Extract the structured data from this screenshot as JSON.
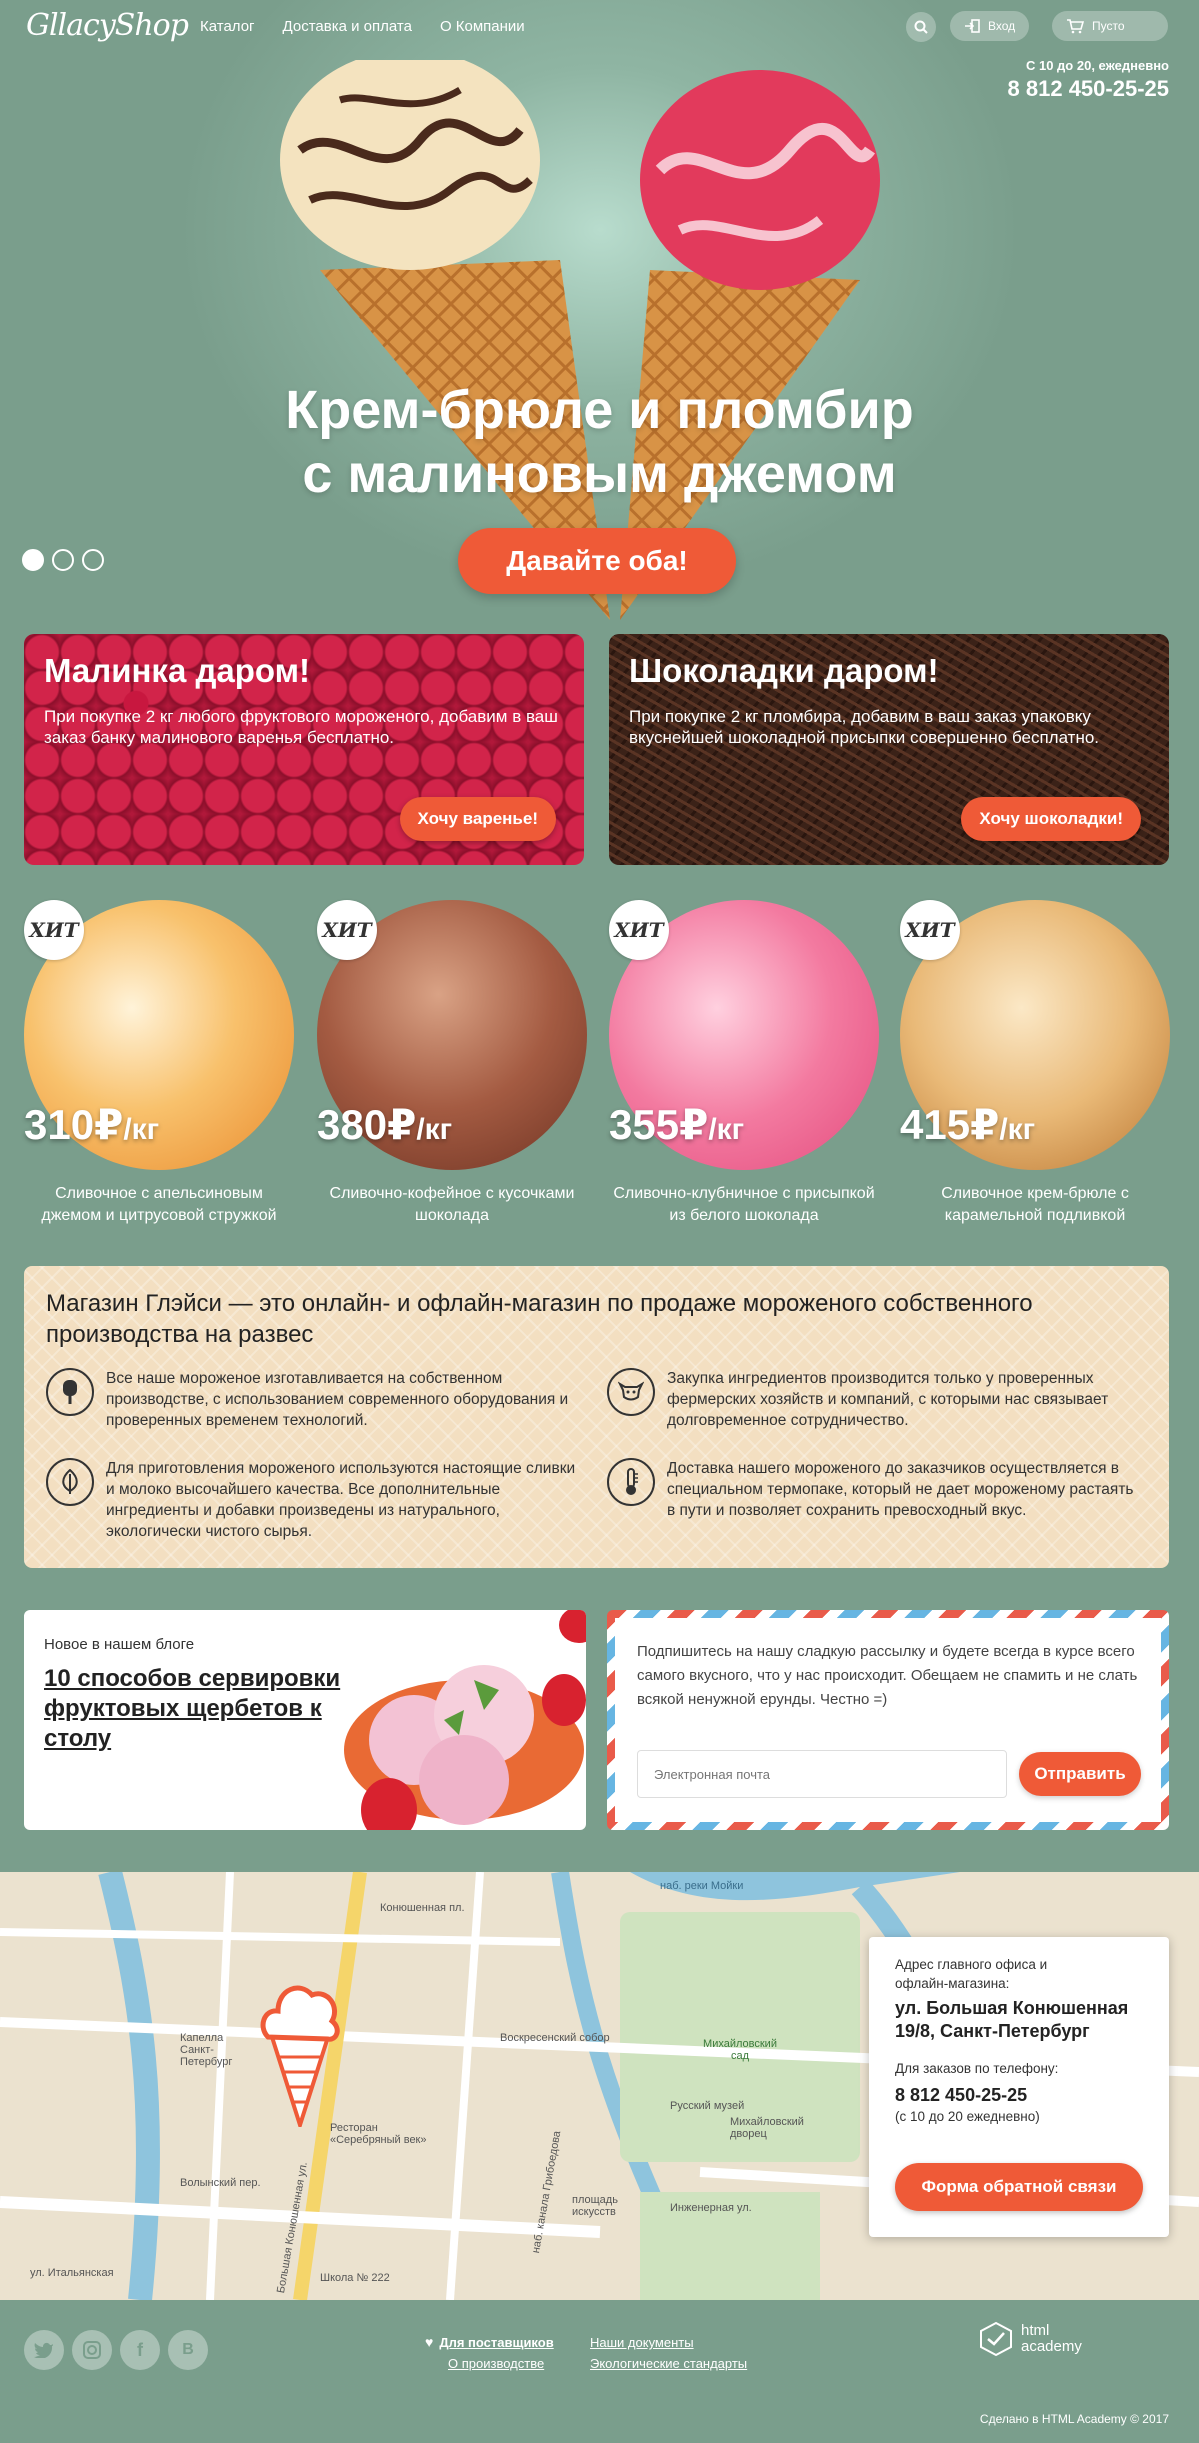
{
  "header": {
    "logo": "GllacyShop",
    "nav": [
      "Каталог",
      "Доставка и оплата",
      "О Компании"
    ],
    "login_label": "Вход",
    "cart_label": "Пусто",
    "hours": "С 10 до 20, ежедневно",
    "phone": "8 812 450-25-25"
  },
  "hero": {
    "title_line1": "Крем-брюле и пломбир",
    "title_line2": "с малиновым джемом",
    "button": "Давайте оба!",
    "slides_total": 3,
    "active_slide": 1
  },
  "promos": [
    {
      "title": "Малинка даром!",
      "text": "При покупке 2 кг любого фруктового мороженого, добавим в ваш заказ банку малинового варенья бесплатно.",
      "button": "Хочу варенье!"
    },
    {
      "title": "Шоколадки даром!",
      "text": "При покупке 2 кг пломбира, добавим в ваш заказ упаковку вкуснейшей шоколадной присыпки совершенно бесплатно.",
      "button": "Хочу шоколадки!"
    }
  ],
  "products": [
    {
      "badge": "ХИТ",
      "price": "310",
      "currency": "₽",
      "unit": "/кг",
      "name": "Сливочное с апельсиновым джемом и цитрусовой стружкой",
      "color": "#f2a64a"
    },
    {
      "badge": "ХИТ",
      "price": "380",
      "currency": "₽",
      "unit": "/кг",
      "name": "Сливочно-кофейное с кусочками шоколада",
      "color": "#9a5640"
    },
    {
      "badge": "ХИТ",
      "price": "355",
      "currency": "₽",
      "unit": "/кг",
      "name": "Сливочно-клубничное с присыпкой из белого шоколада",
      "color": "#f06f95"
    },
    {
      "badge": "ХИТ",
      "price": "415",
      "currency": "₽",
      "unit": "/кг",
      "name": "Сливочное крем-брюле с карамельной подливкой",
      "color": "#e5b070"
    }
  ],
  "about": {
    "title": "Магазин Глэйси — это онлайн- и офлайн-магазин по продаже мороженого собственного производства на развес",
    "features": [
      "Все наше мороженое изготавливается на собственном производстве, с использованием современного оборудования и проверенных временем технологий.",
      "Закупка ингредиентов производится только у проверенных фермерских хозяйств и компаний, с которыми нас связывает долговременное сотрудничество.",
      "Для приготовления мороженого используются настоящие сливки и молоко высочайшего качества. Все дополнительные ингредиенты и добавки произведены из натурального, экологически чистого сырья.",
      "Доставка нашего мороженого до заказчиков осуществляется в специальном термопаке, который не дает мороженому растаять в пути и позволяет сохранить превосходный вкус."
    ]
  },
  "blog": {
    "label": "Новое в нашем блоге",
    "title": "10 способов сервировки фруктовых щербетов к столу"
  },
  "subscribe": {
    "text": "Подпишитесь на нашу сладкую рассылку и будете всегда в курсе всего самого вкусного, что у нас происходит. Обещаем не спамить и не слать всякой ненужной ерунды. Честно =)",
    "placeholder": "Электронная почта",
    "button": "Отправить"
  },
  "map": {
    "labels": [
      "Конюшенная пл.",
      "наб. реки Мойки",
      "Воскресенский собор",
      "Михайловский сад",
      "Русский музей",
      "Михайловский дворец",
      "площадь искусств",
      "Инженерная ул.",
      "Волынский пер.",
      "Школа № 222",
      "ул. Итальянская",
      "Капелла Санкт-Петербург",
      "Ресторан «Серебряный век»",
      "наб. канала Грибоедова",
      "Большая Конюшенная ул."
    ]
  },
  "contact": {
    "address_label": "Адрес главного офиса и офлайн-магазина:",
    "address": "ул. Большая Конюшенная 19/8, Санкт-Петербург",
    "phone_label": "Для заказов по телефону:",
    "phone": "8 812 450-25-25",
    "hours": "(с 10 до 20 ежедневно)",
    "button": "Форма обратной связи"
  },
  "footer": {
    "social": [
      "twitter",
      "instagram",
      "facebook",
      "vkontakte"
    ],
    "links_left": [
      "Для поставщиков",
      "О производстве"
    ],
    "links_right": [
      "Наши документы",
      "Экологические стандарты"
    ],
    "academy": "html academy",
    "made": "Сделано в HTML Academy © 2017"
  }
}
